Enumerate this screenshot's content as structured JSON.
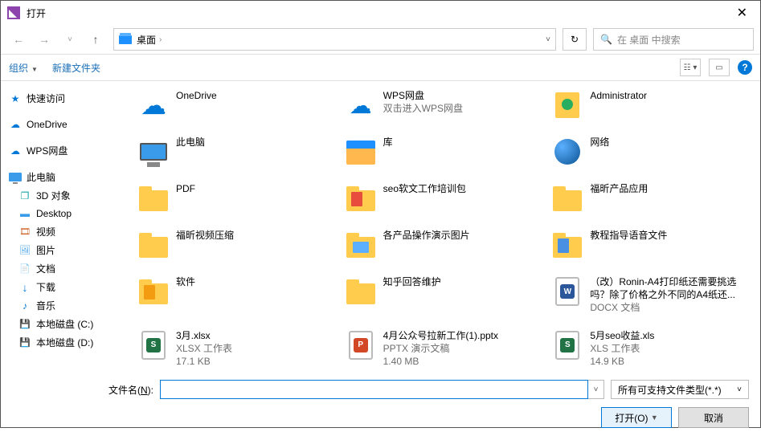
{
  "title": "打开",
  "nav": {
    "location_label": "桌面"
  },
  "search": {
    "placeholder": "在 桌面 中搜索"
  },
  "toolbar": {
    "organize": "组织",
    "newfolder": "新建文件夹",
    "help": "?"
  },
  "sidebar": {
    "quick": "快速访问",
    "onedrive": "OneDrive",
    "wps": "WPS网盘",
    "thispc": "此电脑",
    "obj3d": "3D 对象",
    "desktop": "Desktop",
    "video": "视频",
    "pictures": "图片",
    "documents": "文档",
    "downloads": "下载",
    "music": "音乐",
    "diskc": "本地磁盘 (C:)",
    "diskd": "本地磁盘 (D:)"
  },
  "files": [
    {
      "name": "OneDrive"
    },
    {
      "name": "WPS网盘",
      "sub": "双击进入WPS网盘"
    },
    {
      "name": "Administrator"
    },
    {
      "name": "此电脑"
    },
    {
      "name": "库"
    },
    {
      "name": "网络"
    },
    {
      "name": "PDF"
    },
    {
      "name": "seo软文工作培训包"
    },
    {
      "name": "福昕产品应用"
    },
    {
      "name": "福昕视频压缩"
    },
    {
      "name": "各产品操作演示图片"
    },
    {
      "name": "教程指导语音文件"
    },
    {
      "name": "软件"
    },
    {
      "name": "知乎回答维护"
    },
    {
      "name": "（改）Ronin-A4打印纸还需要挑选吗？除了价格之外不同的A4纸还...",
      "sub": "DOCX 文档"
    },
    {
      "name": "3月.xlsx",
      "sub": "XLSX 工作表",
      "size": "17.1 KB"
    },
    {
      "name": "4月公众号拉新工作(1).pptx",
      "sub": "PPTX 演示文稿",
      "size": "1.40 MB"
    },
    {
      "name": "5月seo收益.xls",
      "sub": "XLS 工作表",
      "size": "14.9 KB"
    }
  ],
  "footer": {
    "filename_label": "文件名(<u>N</u>):",
    "filter": "所有可支持文件类型(*.*)",
    "open": "打开(O)",
    "cancel": "取消"
  }
}
